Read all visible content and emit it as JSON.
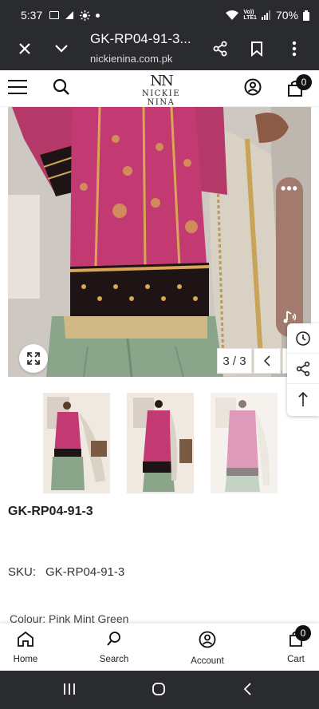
{
  "status_bar": {
    "time": "5:37",
    "network": "Vo))\nLTE1",
    "battery": "70%"
  },
  "browser": {
    "title": "GK-RP04-91-3...",
    "url": "nickienina.com.pk"
  },
  "site_header": {
    "logo_mark": "NN",
    "logo_text": "NICKIE NINA",
    "cart_count": "0"
  },
  "gallery": {
    "counter": "3 / 3",
    "colors": {
      "kurta_pink": "#c33a73",
      "kurta_gold": "#d8a654",
      "border_black": "#1e1416",
      "sharara_green": "#8aa58a",
      "dupatta": "#d9d1c3",
      "background": "#c8c3be"
    }
  },
  "floating": {
    "menu_dots": "•••",
    "pill_color": "#a27b6e"
  },
  "product": {
    "title": "GK-RP04-91-3",
    "sku_label": "SKU:",
    "sku_value": "GK-RP04-91-3",
    "colour_label": "Colour:",
    "colour_value": "Pink Mint Green"
  },
  "bottom_nav": {
    "home": "Home",
    "search": "Search",
    "account": "Account",
    "cart": "Cart",
    "cart_count": "0"
  }
}
